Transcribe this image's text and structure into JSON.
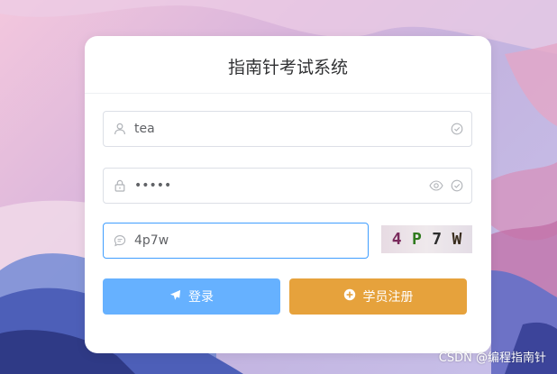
{
  "title": "指南针考试系统",
  "username": {
    "value": "tea",
    "icon": "user-icon",
    "status_icon": "check-circle-icon"
  },
  "password": {
    "value": "•••••",
    "icon": "lock-icon",
    "toggle_icon": "eye-icon",
    "status_icon": "check-circle-icon"
  },
  "captcha": {
    "value": "4p7w",
    "icon": "message-icon",
    "chars": [
      "4",
      "P",
      "7",
      "W"
    ],
    "char_colors": [
      "#7a2a5c",
      "#2f7a1e",
      "#2d2d2d",
      "#3a2d1e"
    ]
  },
  "buttons": {
    "login": {
      "label": "登录",
      "icon": "send-icon",
      "color": "#66b1ff"
    },
    "register": {
      "label": "学员注册",
      "icon": "plus-circle-icon",
      "color": "#e6a23c"
    }
  },
  "watermark": "CSDN @编程指南针",
  "colors": {
    "focus": "#409eff",
    "border": "#dcdfe6"
  }
}
